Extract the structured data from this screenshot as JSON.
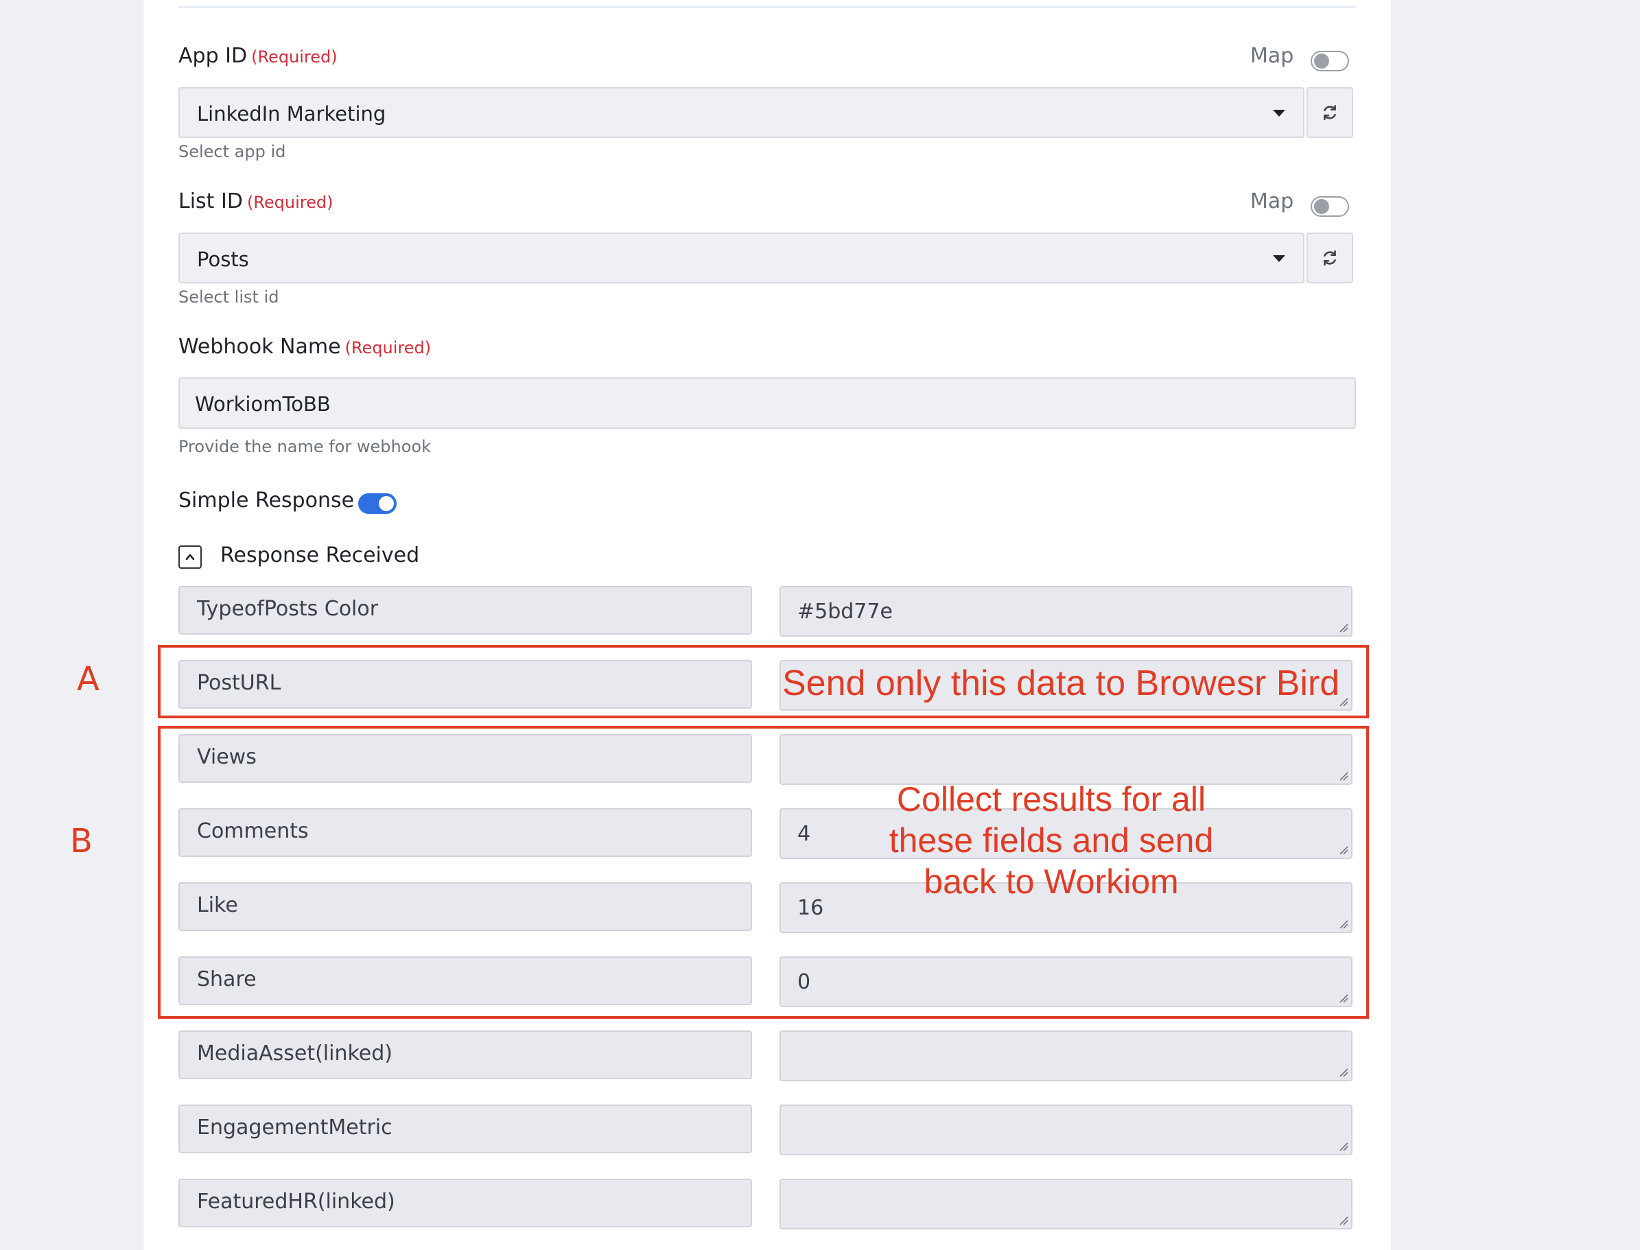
{
  "app_id": {
    "label": "App ID",
    "required": "(Required)",
    "map_label": "Map",
    "value": "LinkedIn Marketing",
    "help": "Select app id"
  },
  "list_id": {
    "label": "List ID",
    "required": "(Required)",
    "map_label": "Map",
    "value": "Posts",
    "help": "Select list id"
  },
  "webhook_name": {
    "label": "Webhook Name",
    "required": "(Required)",
    "value": "WorkiomToBB",
    "help": "Provide the name for webhook"
  },
  "simple_response": {
    "label": "Simple Response",
    "enabled": true
  },
  "response_received": {
    "label": "Response Received",
    "rows": [
      {
        "key": "TypeofPosts Color",
        "value": "#5bd77e"
      },
      {
        "key": "PostURL",
        "value": ""
      },
      {
        "key": "Views",
        "value": ""
      },
      {
        "key": "Comments",
        "value": "4"
      },
      {
        "key": "Like",
        "value": "16"
      },
      {
        "key": "Share",
        "value": "0"
      },
      {
        "key": "MediaAsset(linked)",
        "value": ""
      },
      {
        "key": "EngagementMetric",
        "value": ""
      },
      {
        "key": "FeaturedHR(linked)",
        "value": ""
      }
    ]
  },
  "annotations": {
    "a_letter": "A",
    "b_letter": "B",
    "a_text": "Send only this data to Browesr Bird",
    "b_line1": "Collect results for all",
    "b_line2": "these fields and send",
    "b_line3": "back to Workiom",
    "color": "#e03c25"
  },
  "colors": {
    "required": "#d12f3a",
    "toggle_on": "#2f6fe0"
  }
}
